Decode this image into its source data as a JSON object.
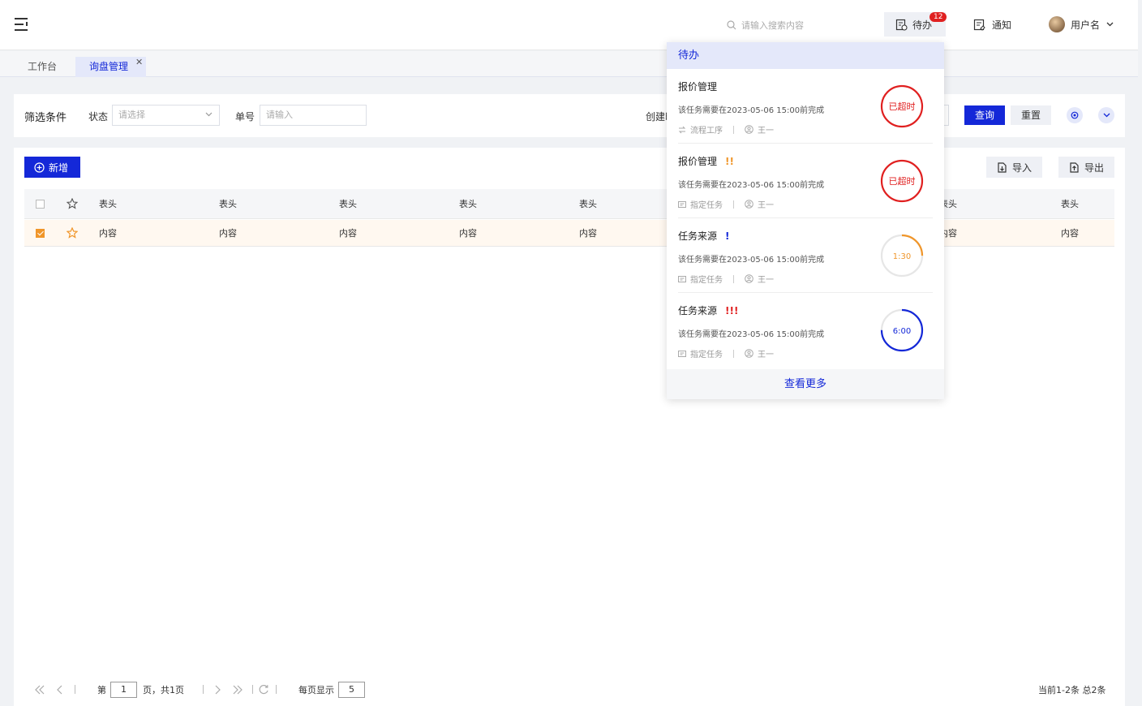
{
  "header": {
    "search_placeholder": "请输入搜索内容",
    "todo_label": "待办",
    "todo_badge": "12",
    "notice_label": "通知",
    "user_name": "用户名"
  },
  "tabs": [
    {
      "label": "工作台"
    },
    {
      "label": "询盘管理",
      "close": "✕"
    }
  ],
  "filter": {
    "title": "筛选条件",
    "status_label": "状态",
    "status_placeholder": "请选择",
    "order_label": "单号",
    "order_placeholder": "请输入",
    "created_label": "创建时间",
    "query_label": "查询",
    "reset_label": "重置"
  },
  "toolbar": {
    "add_label": "新增",
    "import_label": "导入",
    "export_label": "导出"
  },
  "table": {
    "headers": [
      "表头",
      "表头",
      "表头",
      "表头",
      "表头",
      "表头",
      "表头",
      "表头"
    ],
    "row": [
      "内容",
      "内容",
      "内容",
      "内容",
      "内容",
      "内容",
      "内容",
      "内容"
    ]
  },
  "pagination": {
    "page_prefix": "第",
    "current_page": "1",
    "page_suffix": "页，共1页",
    "per_page_label": "每页显示",
    "per_page": "5",
    "summary": "当前1-2条 总2条"
  },
  "todo_dropdown": {
    "title": "待办",
    "items": [
      {
        "title": "报价管理",
        "mark": "",
        "desc": "该任务需要在2023-05-06 15:00前完成",
        "type": "流程工序",
        "person": "王一",
        "timer": "已超时",
        "progress": 1.0,
        "color": "#e02020"
      },
      {
        "title": "报价管理",
        "mark": "!!",
        "mark_color": "#f0962a",
        "desc": "该任务需要在2023-05-06 15:00前完成",
        "type": "指定任务",
        "person": "王一",
        "timer": "已超时",
        "progress": 1.0,
        "color": "#e02020"
      },
      {
        "title": "任务来源",
        "mark": "!",
        "mark_color": "#1428d8",
        "desc": "该任务需要在2023-05-06 15:00前完成",
        "type": "指定任务",
        "person": "王一",
        "timer": "1:30",
        "progress": 0.25,
        "color": "#f0962a"
      },
      {
        "title": "任务来源",
        "mark": "!!!",
        "mark_color": "#e02020",
        "desc": "该任务需要在2023-05-06 15:00前完成",
        "type": "指定任务",
        "person": "王一",
        "timer": "6:00",
        "progress": 0.75,
        "color": "#1428d8"
      }
    ],
    "more_label": "查看更多"
  }
}
